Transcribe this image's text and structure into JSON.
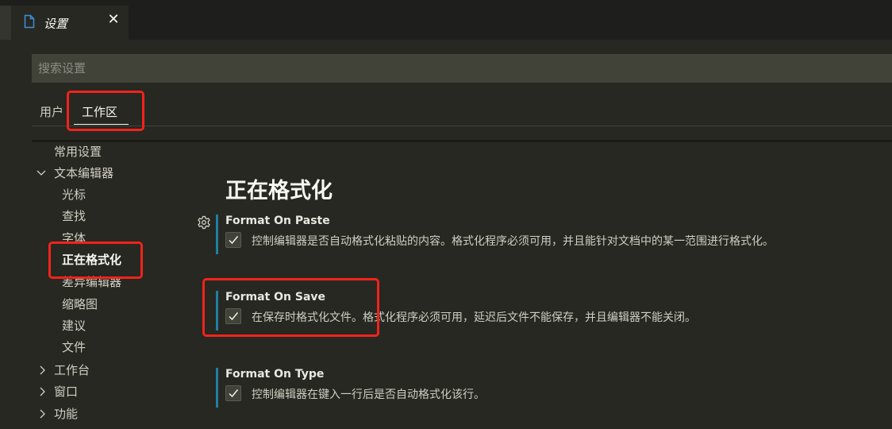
{
  "editor_tab": {
    "icon": "file-icon",
    "title": "设置",
    "close_icon": "close-icon"
  },
  "search": {
    "placeholder": "搜索设置",
    "value": ""
  },
  "scope_tabs": [
    {
      "label": "用户",
      "active": false
    },
    {
      "label": "工作区",
      "active": true
    }
  ],
  "toc": [
    {
      "label": "常用设置",
      "level": 0,
      "twisty": ""
    },
    {
      "label": "文本编辑器",
      "level": 0,
      "twisty": "expanded"
    },
    {
      "label": "光标",
      "level": 1,
      "twisty": ""
    },
    {
      "label": "查找",
      "level": 1,
      "twisty": ""
    },
    {
      "label": "字体",
      "level": 1,
      "twisty": ""
    },
    {
      "label": "正在格式化",
      "level": 1,
      "twisty": "",
      "active": true
    },
    {
      "label": "差异编辑器",
      "level": 1,
      "twisty": ""
    },
    {
      "label": "缩略图",
      "level": 1,
      "twisty": ""
    },
    {
      "label": "建议",
      "level": 1,
      "twisty": ""
    },
    {
      "label": "文件",
      "level": 1,
      "twisty": ""
    },
    {
      "label": "工作台",
      "level": 0,
      "twisty": "collapsed"
    },
    {
      "label": "窗口",
      "level": 0,
      "twisty": "collapsed"
    },
    {
      "label": "功能",
      "level": 0,
      "twisty": "collapsed"
    }
  ],
  "section": {
    "title": "正在格式化"
  },
  "settings": [
    {
      "title": "Format On Paste",
      "checked": true,
      "description": "控制编辑器是否自动格式化粘贴的内容。格式化程序必须可用，并且能针对文档中的某一范围进行格式化。"
    },
    {
      "title": "Format On Save",
      "checked": true,
      "description": "在保存时格式化文件。格式化程序必须可用，延迟后文件不能保存，并且编辑器不能关闭。"
    },
    {
      "title": "Format On Type",
      "checked": true,
      "description": "控制编辑器在键入一行后是否自动格式化该行。"
    }
  ],
  "colors": {
    "accent_bar": "#1e7fa3",
    "annotation": "#f2231b",
    "background": "#272822",
    "input_bg": "#414339"
  }
}
